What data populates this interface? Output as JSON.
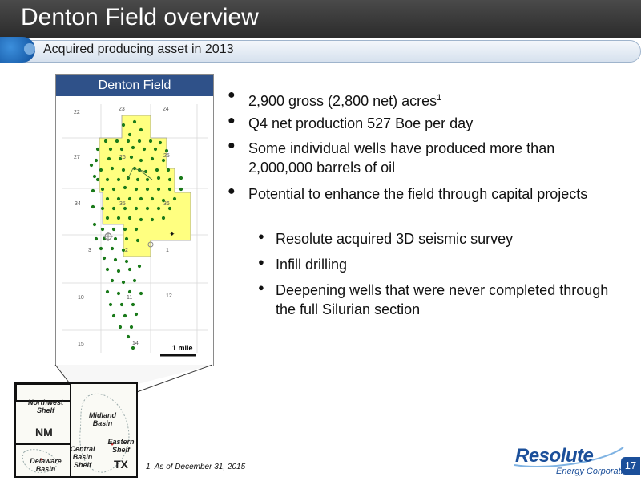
{
  "title": "Denton Field overview",
  "subtitle": "Acquired producing asset in 2013",
  "map": {
    "header": "Denton Field",
    "scale_label": "1 mile",
    "section_numbers": [
      "22",
      "23",
      "24",
      "27",
      "26",
      "25",
      "34",
      "35",
      "36",
      "3",
      "2",
      "1",
      "10",
      "11",
      "12",
      "15",
      "14"
    ]
  },
  "inset": {
    "labels": {
      "northwest_shelf": "Northwest Shelf",
      "nm": "NM",
      "midland_basin": "Midland Basin",
      "central_basin_shelf": "Central Basin Shelf",
      "eastern_shelf": "Eastern Shelf",
      "delaware_basin": "Delaware Basin",
      "tx": "TX"
    }
  },
  "bullets": [
    {
      "text": "2,900 gross (2,800 net) acres",
      "sup": "1"
    },
    {
      "text": "Q4 net production 527 Boe per day"
    },
    {
      "text": "Some individual wells have produced more than 2,000,000 barrels of oil"
    },
    {
      "text": "Potential to enhance the field through capital projects"
    }
  ],
  "sub_bullets": [
    {
      "text": "Resolute acquired 3D seismic survey"
    },
    {
      "text": "Infill drilling"
    },
    {
      "text": "Deepening wells that were never completed through the full Silurian section"
    }
  ],
  "footnote": "1.  As of December 31, 2015",
  "logo": {
    "name": "Resolute",
    "tagline": "Energy Corporation"
  },
  "page_number": "17",
  "colors": {
    "title_bg": "#333333",
    "map_header": "#2f5189",
    "acreage": "#ffff80",
    "wells": "#1a7a1a",
    "brand": "#1b4f9a"
  }
}
